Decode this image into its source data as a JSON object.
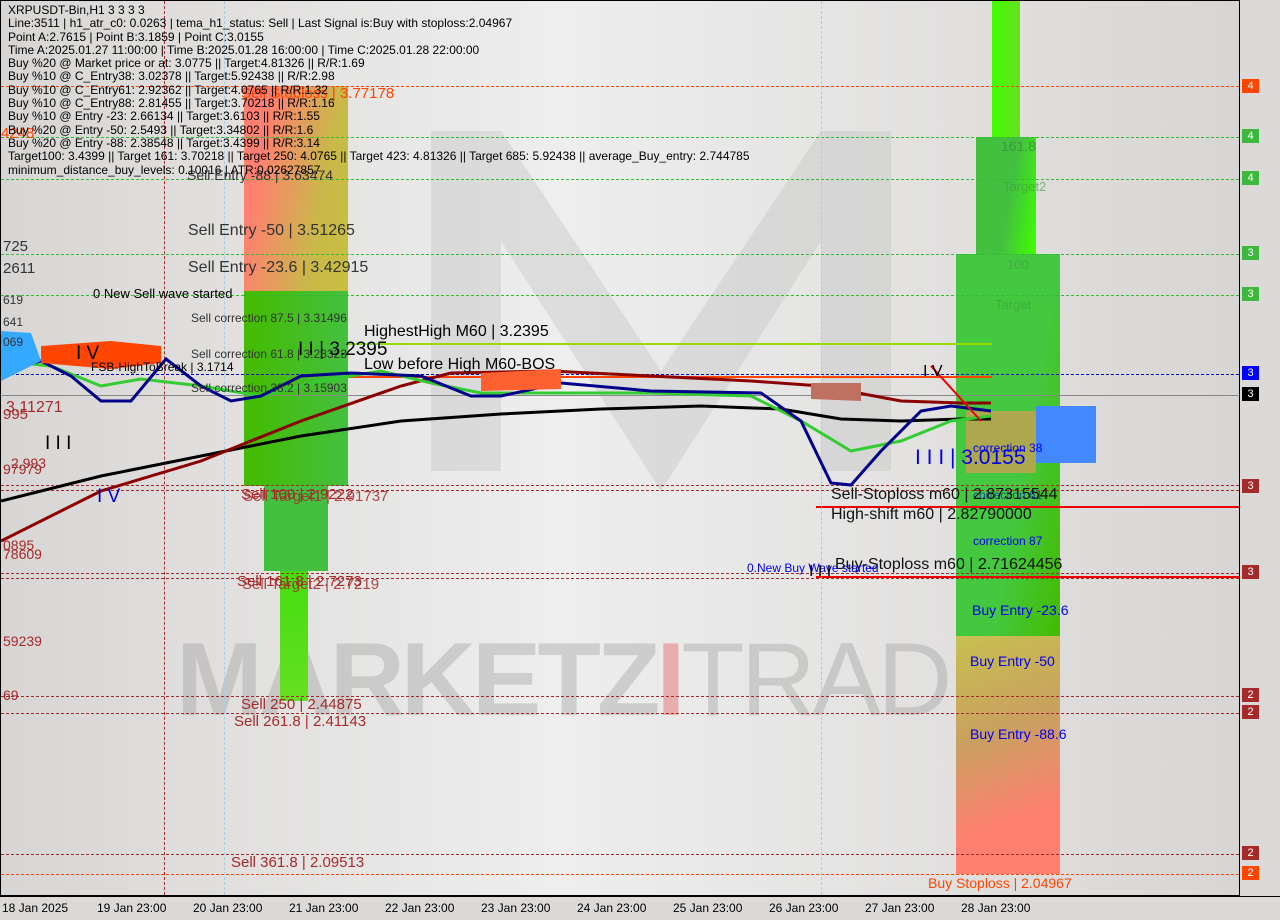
{
  "header": {
    "symbol": "XRPUSDT-Bin,H1  3 3 3 3",
    "lines": [
      "Line:3511 | h1_atr_c0: 0.0263 | tema_h1_status: Sell | Last Signal is:Buy with stoploss:2.04967",
      "Point A:2.7615 | Point B:3.1859 | Point C:3.0155",
      "Time A:2025.01.27 11:00:00 | Time B:2025.01.28 16:00:00 | Time C:2025.01.28 22:00:00",
      "Buy %20 @ Market price or at: 3.0775 || Target:4.81326 || R/R:1.69",
      "Buy %10 @ C_Entry38: 3.02378 || Target:5.92438 || R/R:2.98",
      "Buy %10 @ C_Entry61: 2.92362 || Target:4.0765 || R/R:1.32",
      "Buy %10 @ C_Entry88: 2.81455 || Target:3.70218 || R/R:1.16",
      "Buy %10 @ Entry -23: 2.66134 || Target:3.6103 || R/R:1.55",
      "Buy %20 @ Entry -50: 2.5493 || Target:3.34802 || R/R:1.6",
      "Buy %20 @ Entry -88: 2.38548 || Target:3.4399 || R/R:3.14",
      "Target100: 3.4399 || Target 161: 3.70218 || Target 250: 4.0765 || Target 423: 4.81326 || Target 685: 5.92438 || average_Buy_entry: 2.744785",
      "minimum_distance_buy_levels: 0.10016 | ATR:0.02627857"
    ]
  },
  "labels": {
    "sell_stoploss": "Sell Stoploss | 3.77178",
    "left_4248": "4248",
    "sell_entry_88": "Sell Entry -88 | 3.63474",
    "sell_entry_50": "Sell Entry -50 | 3.51265",
    "sell_entry_23": "Sell Entry -23.6 | 3.42915",
    "left_725": "725",
    "left_2611": "2611",
    "left_619": "619",
    "left_641": "641",
    "left_069": "069",
    "new_sell_wave": "0 New Sell wave started",
    "sell_corr_875": "Sell correction 87.5 | 3.31496",
    "sell_corr_618": "Sell correction 61.8 | 3.23323",
    "sell_corr_382": "Sell correction 38.2 | 3.15903",
    "fsb": "FSB-HighToBreak | 3.1714",
    "highest_high": "HighestHigh   M60 | 3.2395",
    "wave_ii": "I I | 3.2395",
    "low_before_high": "Low before High   M60-BOS",
    "wave_iv_left": "I V",
    "wave_iii_left": "I I I",
    "wave_iv_low": "I V",
    "wave_iv_right": "I V",
    "left_311271": "3.11271",
    "left_995": "995",
    "left_2993": "2.993",
    "left_97979": "97979",
    "left_0895": "0895",
    "left_78609": "78609",
    "left_59239": "59239",
    "left_69": "69",
    "sell_target1": "Sell Target1 | 2.91737",
    "sell_100": "Sell 100 | 2.9222",
    "sell_target2": "Sell Target2 | 2.7219",
    "sell_1618": "Sell 161.8 | 2.7273",
    "sell_250": "Sell  250 | 2.44875",
    "sell_2618": "Sell  261.8 | 2.41143",
    "sell_3618": "Sell  361.8 | 2.09513",
    "wave_iii_right": "I I I | 3.0155",
    "correction_38": "correction 38",
    "correction_61": "correction 61",
    "correction_87": "correction 87",
    "sell_stoploss_m60": "Sell-Stoploss m60 | 2.87315544",
    "high_shift_m60": "High-shift m60 | 2.82790000",
    "buy_stoploss_m60": "Buy-Stoploss m60 | 2.71624456",
    "new_buy_wave": "0.New Buy Wave started",
    "wave_i": "I I I",
    "buy_entry_23": "Buy Entry -23.6",
    "buy_entry_50": "Buy Entry -50",
    "buy_entry_88": "Buy Entry -88.6",
    "buy_stoploss": "Buy Stoploss | 2.04967",
    "t1618": "161.8",
    "target2": "Target2",
    "t100": "100",
    "target": "Target"
  },
  "watermark": {
    "part1": "MARKETZ",
    "part2": "I",
    "part3": "TRADE"
  },
  "price_axis": {
    "tags": [
      {
        "text": "4",
        "color": "#ff4500"
      },
      {
        "text": "4",
        "color": "#3cb83c"
      },
      {
        "text": "4",
        "color": "#3cb83c"
      },
      {
        "text": "3",
        "color": "#3cb83c"
      },
      {
        "text": "3",
        "color": "#3cb83c"
      },
      {
        "text": "3",
        "color": "#0000ff"
      },
      {
        "text": "3",
        "color": "#000000"
      },
      {
        "text": "3",
        "color": "#a52a2a"
      },
      {
        "text": "3",
        "color": "#a52a2a"
      },
      {
        "text": "2",
        "color": "#a52a2a"
      },
      {
        "text": "2",
        "color": "#a52a2a"
      },
      {
        "text": "2",
        "color": "#a52a2a"
      },
      {
        "text": "2",
        "color": "#ff4500"
      }
    ]
  },
  "time_axis": [
    "18 Jan 2025",
    "19 Jan 23:00",
    "20 Jan 23:00",
    "21 Jan 23:00",
    "22 Jan 23:00",
    "23 Jan 23:00",
    "24 Jan 23:00",
    "25 Jan 23:00",
    "26 Jan 23:00",
    "27 Jan 23:00",
    "28 Jan 23:00"
  ],
  "colors": {
    "sell_zone_red": "#ff8070",
    "zone_green": "#44c040",
    "bright_green": "#40ff00",
    "ma_black": "#000000",
    "ma_darkred": "#8b0000",
    "ma_navy": "#00008b",
    "ma_green": "#33cc33"
  }
}
